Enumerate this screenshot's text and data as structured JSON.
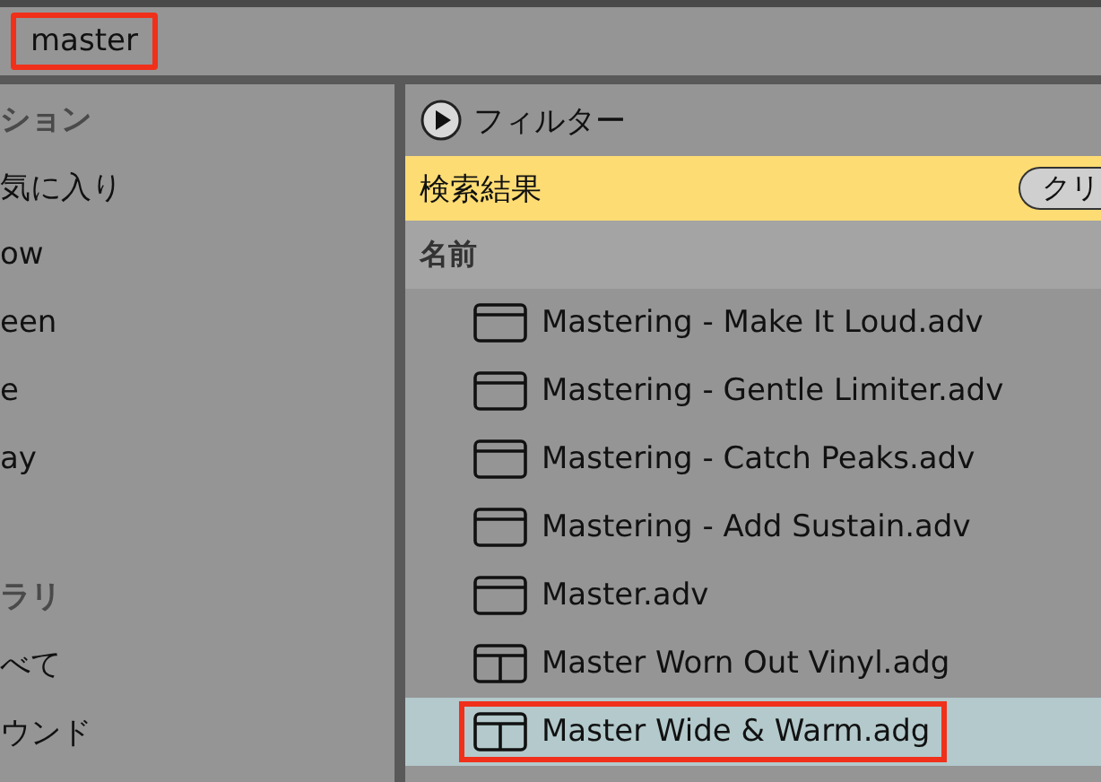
{
  "search": {
    "value": "master",
    "highlighted": true
  },
  "sidebar": {
    "items": [
      {
        "kind": "header",
        "label": "ション"
      },
      {
        "kind": "item",
        "label": "気に入り"
      },
      {
        "kind": "item",
        "label": "ow"
      },
      {
        "kind": "item",
        "label": "een"
      },
      {
        "kind": "item",
        "label": "e"
      },
      {
        "kind": "item",
        "label": "ay"
      },
      {
        "kind": "spacer"
      },
      {
        "kind": "header",
        "label": "ラリ"
      },
      {
        "kind": "item",
        "label": "べて"
      },
      {
        "kind": "item",
        "label": "ウンド"
      }
    ]
  },
  "filter": {
    "label": "フィルター"
  },
  "results_bar": {
    "title": "検索結果",
    "button": "クリ"
  },
  "table": {
    "columns": [
      "名前"
    ],
    "rows": [
      {
        "kind": "device",
        "name": "Mastering - Make It Loud.adv",
        "selected": false,
        "highlighted": false
      },
      {
        "kind": "device",
        "name": "Mastering - Gentle Limiter.adv",
        "selected": false,
        "highlighted": false
      },
      {
        "kind": "device",
        "name": "Mastering - Catch Peaks.adv",
        "selected": false,
        "highlighted": false
      },
      {
        "kind": "device",
        "name": "Mastering - Add Sustain.adv",
        "selected": false,
        "highlighted": false
      },
      {
        "kind": "device",
        "name": "Master.adv",
        "selected": false,
        "highlighted": false
      },
      {
        "kind": "group",
        "name": "Master Worn Out Vinyl.adg",
        "selected": false,
        "highlighted": false
      },
      {
        "kind": "group",
        "name": "Master Wide & Warm.adg",
        "selected": true,
        "highlighted": true
      }
    ]
  }
}
